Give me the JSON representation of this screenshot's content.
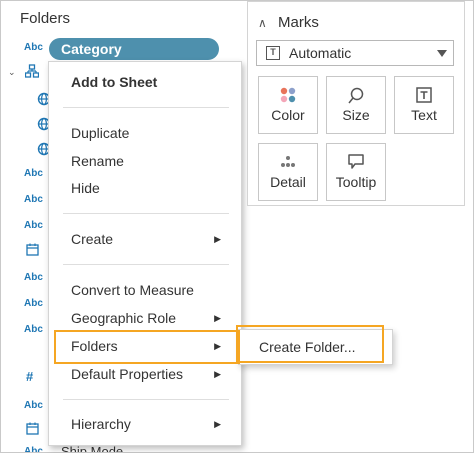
{
  "data_pane": {
    "title": "Folders",
    "selected_field": "Category",
    "hidden_field_below": "Ship Mode",
    "field_icons": [
      "Abc",
      "hierarchy",
      "globe",
      "globe",
      "globe",
      "Abc",
      "Abc",
      "Abc",
      "calendar",
      "Abc",
      "Abc",
      "Abc",
      "#",
      "Abc",
      "calendar",
      "Abc"
    ]
  },
  "context_menu": {
    "items": [
      {
        "label": "Add to Sheet",
        "has_submenu": false
      },
      {
        "label": "Duplicate",
        "has_submenu": false
      },
      {
        "label": "Rename",
        "has_submenu": false
      },
      {
        "label": "Hide",
        "has_submenu": false
      },
      {
        "label": "Create",
        "has_submenu": true
      },
      {
        "label": "Convert to Measure",
        "has_submenu": false
      },
      {
        "label": "Geographic Role",
        "has_submenu": true
      },
      {
        "label": "Folders",
        "has_submenu": true
      },
      {
        "label": "Default Properties",
        "has_submenu": true
      },
      {
        "label": "Hierarchy",
        "has_submenu": true
      }
    ]
  },
  "submenu": {
    "items": [
      {
        "label": "Create Folder..."
      }
    ]
  },
  "marks_card": {
    "title": "Marks",
    "mark_type": "Automatic",
    "buttons": [
      {
        "label": "Color",
        "icon": "color-dots-icon"
      },
      {
        "label": "Size",
        "icon": "size-lasso-icon"
      },
      {
        "label": "Text",
        "icon": "text-box-icon"
      },
      {
        "label": "Detail",
        "icon": "detail-dots-icon"
      },
      {
        "label": "Tooltip",
        "icon": "tooltip-bubble-icon"
      }
    ]
  },
  "colors": {
    "accent_pill": "#4e90ad",
    "highlight": "#f5a623",
    "field_icon_blue": "#1f77b4"
  }
}
